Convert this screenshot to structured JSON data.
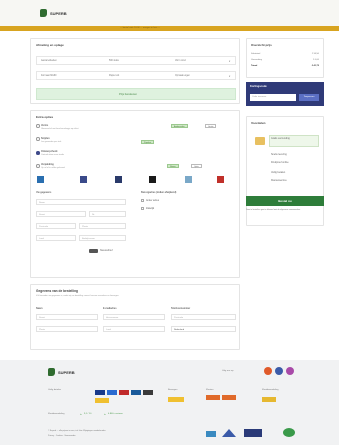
{
  "header": {
    "logo_text": "SUPERB",
    "promo_text": "— bestel vóór 16:00 — morgen in huis —"
  },
  "product_card": {
    "title": "Afmeting en oplage",
    "rows": [
      [
        "Aantal etiketten",
        "500 stuks",
        "Vorm rond"
      ],
      [
        "Formaat 60x60",
        "Papier wit",
        "Opmaak eigen"
      ]
    ],
    "greenbar": "Prijs berekenen"
  },
  "options": {
    "title": "Extra opties",
    "items": [
      {
        "label": "Vernis",
        "desc": "Glanzend of mat beschermlaagje op etiket",
        "tag1": "Aanbevolen",
        "tag2": "Gratis"
      },
      {
        "label": "Snijden",
        "desc": "Los gesneden per stuk",
        "tag1": "Populair",
        "tag2": ""
      },
      {
        "label": "Ontwerpcheck",
        "desc": "Controle door onze studio",
        "tag1": "",
        "tag2": ""
      },
      {
        "label": "Verpakking",
        "desc": "Op rol of in vellen geleverd",
        "tag1": "Nieuw",
        "tag2": "Optie"
      }
    ],
    "swatch_colors": [
      "#2a6fb0",
      "#3a4a8a",
      "#2a3a6a",
      "#1a1a1a",
      "#7aa8c8",
      "#c0302a"
    ],
    "left_fields_title": "Uw gegevens",
    "right_fields_title": "Bezorgadres (indien afwijkend)",
    "fields": [
      "Naam",
      "Bedrijfsnaam",
      "Straat",
      "Nr.",
      "Postcode",
      "Plaats",
      "Land"
    ],
    "checkboxes": [
      "Ander adres",
      "Zakelijk"
    ],
    "toggle_label": "Nieuwsbrief"
  },
  "billing": {
    "title": "Gegevens van de bestelling",
    "desc": "Vul hieronder uw gegevens in, zodat wij uw bestelling correct kunnen verwerken en bezorgen.",
    "cols": [
      "Naam",
      "E-mailadres",
      "Telefoonnummer"
    ],
    "row2": [
      "Straat",
      "Huisnummer",
      "Postcode"
    ],
    "row3": [
      "Plaats",
      "Land",
      "Nederland"
    ]
  },
  "summary": {
    "title": "Overzicht prijs",
    "lines": [
      {
        "k": "Subtotaal",
        "v": "€ 34,50"
      },
      {
        "k": "Verzending",
        "v": "€ 0,00"
      },
      {
        "k": "Totaal",
        "v": "€ 41,75"
      }
    ],
    "promo_label": "Kortingscode",
    "promo_placeholder": "Code invoeren",
    "promo_button": "Toepassen",
    "usp_title": "Voordelen",
    "usps": [
      "Gratis verzending",
      "Snelle levering",
      "Drukproef online",
      "Veilig betalen",
      "Klantenservice"
    ],
    "order_button": "Bestel nu",
    "legal": "Door te bestellen gaat u akkoord met de algemene voorwaarden."
  },
  "footer": {
    "logo_text": "SUPERB",
    "social_label": "Volg ons op",
    "social_colors": [
      "#e05a2a",
      "#3b5ba8",
      "#a84aa8"
    ],
    "col1_title": "Veilig betalen",
    "col2_title": "Bezorgen",
    "col3_title": "Klanten",
    "rating_label": "Klantbeoordeling",
    "rating_text1": "9,1 / 10",
    "rating_text2": "4.800+ reviews",
    "bottom_text": "© Superb — alle prijzen in euro, incl. btw. Wijzigingen voorbehouden.",
    "bottom_sub": "Privacy · Cookies · Voorwaarden"
  }
}
